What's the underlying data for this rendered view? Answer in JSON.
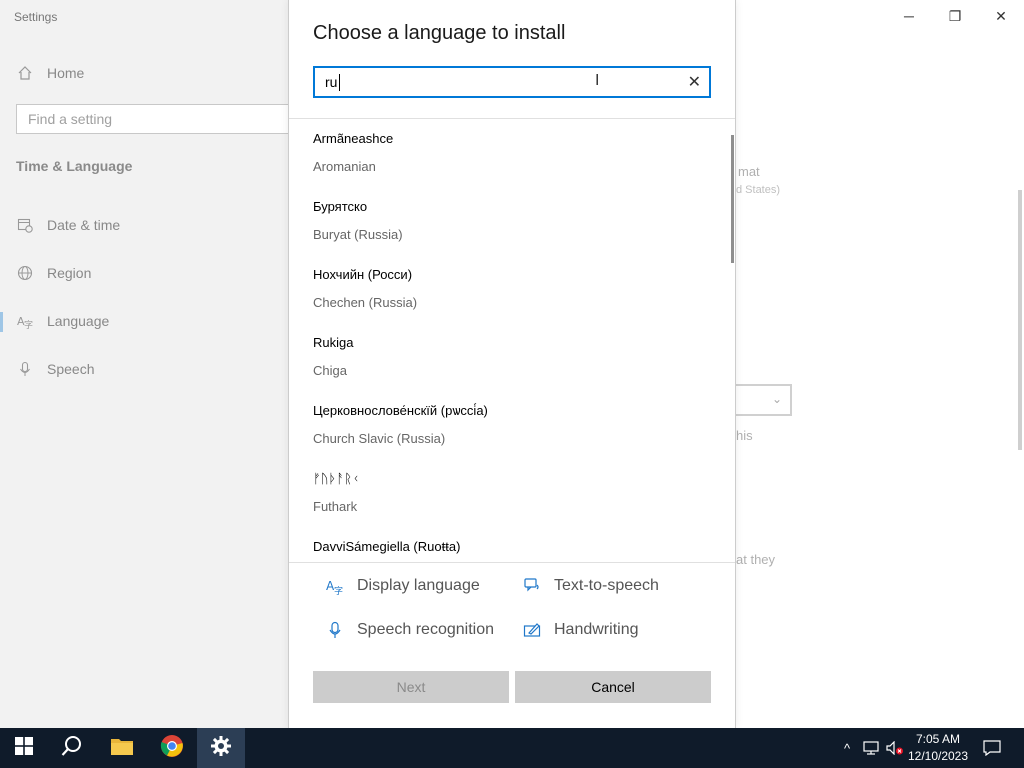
{
  "settings_window": {
    "title": "Settings",
    "home_label": "Home",
    "search_placeholder": "Find a setting",
    "section_title": "Time & Language",
    "nav_items": [
      {
        "label": "Date & time",
        "icon": "calendar-clock-icon"
      },
      {
        "label": "Region",
        "icon": "globe-icon"
      },
      {
        "label": "Language",
        "icon": "language-icon"
      },
      {
        "label": "Speech",
        "icon": "microphone-icon"
      }
    ],
    "controls": {
      "minimize": "─",
      "restore": "❐",
      "close": "✕"
    },
    "background_fragments": [
      "mat",
      "d States)",
      "his",
      "at they"
    ]
  },
  "dialog": {
    "title": "Choose a language to install",
    "search_value": "ru",
    "languages": [
      {
        "native": "Armãneashce",
        "english": "Aromanian"
      },
      {
        "native": "Бурятско",
        "english": "Buryat (Russia)"
      },
      {
        "native": "Нохчийн (Росси)",
        "english": "Chechen (Russia)"
      },
      {
        "native": "Rukiga",
        "english": "Chiga"
      },
      {
        "native": "Церковнослове́нскїй (рѡссі́а)",
        "english": "Church Slavic (Russia)"
      },
      {
        "native": "ᚠᚢᚦᚨᚱᚲ",
        "english": "Futhark"
      },
      {
        "native": "DavviSámegiella (Ruoŧŧa)",
        "english": ""
      }
    ],
    "features": [
      {
        "label": "Display language",
        "icon": "display-language-icon"
      },
      {
        "label": "Text-to-speech",
        "icon": "text-to-speech-icon"
      },
      {
        "label": "Speech recognition",
        "icon": "microphone-icon"
      },
      {
        "label": "Handwriting",
        "icon": "handwriting-icon"
      }
    ],
    "next_label": "Next",
    "cancel_label": "Cancel"
  },
  "taskbar": {
    "time": "7:05 AM",
    "date": "12/10/2023"
  },
  "colors": {
    "accent": "#0078d7",
    "taskbar": "#0f1b2a",
    "button_gray": "#cccccc"
  }
}
